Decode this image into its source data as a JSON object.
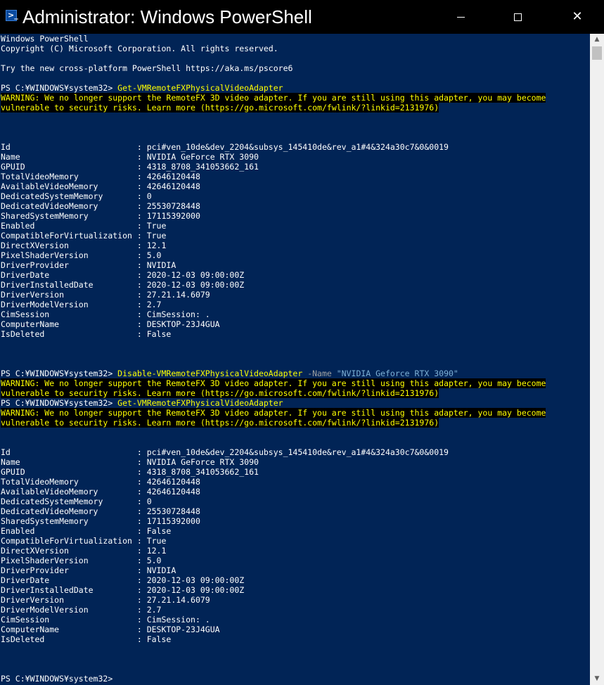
{
  "window": {
    "title": "Administrator: Windows PowerShell",
    "icon": "powershell-icon",
    "controls": {
      "minimize": "minimize-icon",
      "maximize": "maximize-icon",
      "close": "close-icon",
      "close_glyph": "✕"
    }
  },
  "colors": {
    "console_bg": "#012456",
    "warning_fg": "#ffff00",
    "warning_bg": "#000000",
    "command_fg": "#ffff00",
    "parameter_fg": "#a0a0a0",
    "string_fg": "#7fb1d6"
  },
  "console": {
    "header": [
      "Windows PowerShell",
      "Copyright (C) Microsoft Corporation. All rights reserved.",
      "",
      "Try the new cross-platform PowerShell https://aka.ms/pscore6"
    ],
    "prompt": "PS C:¥WINDOWS¥system32> ",
    "cmd1": "Get-VMRemoteFXPhysicalVideoAdapter",
    "warning_line1": "WARNING: We no longer support the RemoteFX 3D video adapter. If you are still using this adapter, you may become",
    "warning_line2": "vulnerable to security risks. Learn more (https://go.microsoft.com/fwlink/?linkid=2131976)",
    "output1": [
      "Id                          : pci#ven_10de&dev_2204&subsys_145410de&rev_a1#4&324a30c7&0&0019",
      "Name                        : NVIDIA GeForce RTX 3090",
      "GPUID                       : 4318_8708_341053662_161",
      "TotalVideoMemory            : 42646120448",
      "AvailableVideoMemory        : 42646120448",
      "DedicatedSystemMemory       : 0",
      "DedicatedVideoMemory        : 25530728448",
      "SharedSystemMemory          : 17115392000",
      "Enabled                     : True",
      "CompatibleForVirtualization : True",
      "DirectXVersion              : 12.1",
      "PixelShaderVersion          : 5.0",
      "DriverProvider              : NVIDIA",
      "DriverDate                  : 2020-12-03 09:00:00Z",
      "DriverInstalledDate         : 2020-12-03 09:00:00Z",
      "DriverVersion               : 27.21.14.6079",
      "DriverModelVersion          : 2.7",
      "CimSession                  : CimSession: .",
      "ComputerName                : DESKTOP-23J4GUA",
      "IsDeleted                   : False"
    ],
    "cmd2": "Disable-VMRemoteFXPhysicalVideoAdapter",
    "cmd2_param": " -Name ",
    "cmd2_value": "\"NVIDIA Geforce RTX 3090\"",
    "cmd3": "Get-VMRemoteFXPhysicalVideoAdapter",
    "output2": [
      "Id                          : pci#ven_10de&dev_2204&subsys_145410de&rev_a1#4&324a30c7&0&0019",
      "Name                        : NVIDIA GeForce RTX 3090",
      "GPUID                       : 4318_8708_341053662_161",
      "TotalVideoMemory            : 42646120448",
      "AvailableVideoMemory        : 42646120448",
      "DedicatedSystemMemory       : 0",
      "DedicatedVideoMemory        : 25530728448",
      "SharedSystemMemory          : 17115392000",
      "Enabled                     : False",
      "CompatibleForVirtualization : True",
      "DirectXVersion              : 12.1",
      "PixelShaderVersion          : 5.0",
      "DriverProvider              : NVIDIA",
      "DriverDate                  : 2020-12-03 09:00:00Z",
      "DriverInstalledDate         : 2020-12-03 09:00:00Z",
      "DriverVersion               : 27.21.14.6079",
      "DriverModelVersion          : 2.7",
      "CimSession                  : CimSession: .",
      "ComputerName                : DESKTOP-23J4GUA",
      "IsDeleted                   : False"
    ],
    "final_prompt": "PS C:¥WINDOWS¥system32>"
  },
  "scrollbar": {
    "up_glyph": "▲",
    "down_glyph": "▼"
  }
}
